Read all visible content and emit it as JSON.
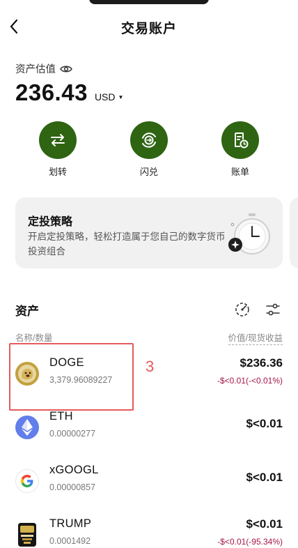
{
  "header": {
    "title": "交易账户",
    "back_label": "返回"
  },
  "valuation": {
    "label": "资产估值",
    "amount": "236.43",
    "currency": "USD"
  },
  "actions": [
    {
      "label": "划转",
      "icon": "transfer-arrows-icon"
    },
    {
      "label": "闪兑",
      "icon": "swap-icon"
    },
    {
      "label": "账单",
      "icon": "bill-clock-icon"
    }
  ],
  "dca": {
    "title": "定投策略",
    "description": "开启定投策略，轻松打造属于您自己的数字货币投资组合",
    "art_icon": "stopwatch-icon"
  },
  "assets": {
    "title": "资产",
    "col_left": "名称/数量",
    "col_right": "价值/现货收益",
    "rows": [
      {
        "symbol": "DOGE",
        "quantity": "3,379.96089227",
        "value": "$236.36",
        "pnl": "-$<0.01(-<0.01%)",
        "icon": "doge-icon"
      },
      {
        "symbol": "ETH",
        "quantity": "0.00000277",
        "value": "$<0.01",
        "pnl": "",
        "icon": "eth-icon"
      },
      {
        "symbol": "xGOOGL",
        "quantity": "0.00000857",
        "value": "$<0.01",
        "pnl": "",
        "icon": "google-icon"
      },
      {
        "symbol": "TRUMP",
        "quantity": "0.0001492",
        "value": "$<0.01",
        "pnl": "-$<0.01(-95.34%)",
        "icon": "trump-icon"
      }
    ]
  },
  "annotation": {
    "number": "3"
  },
  "colors": {
    "accent_green": "#2e6412",
    "loss": "#a4164a",
    "annotation": "#e55a5a"
  }
}
